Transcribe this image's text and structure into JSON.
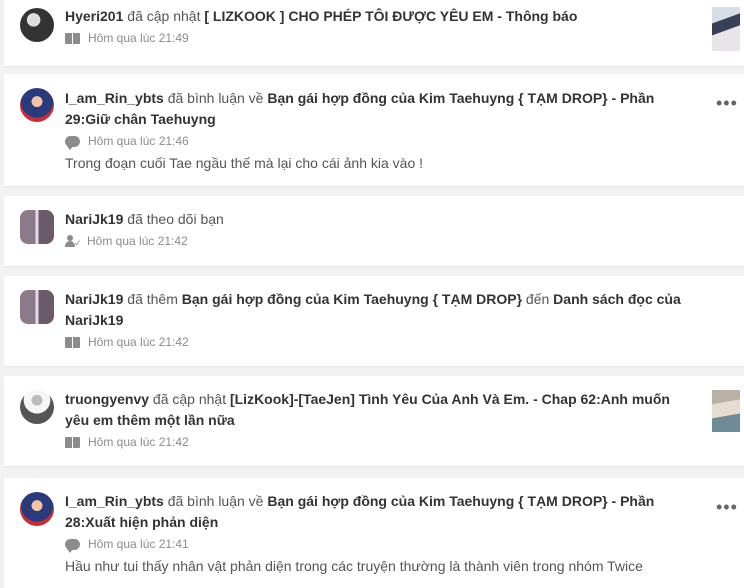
{
  "notifications": [
    {
      "user": "Hyeri201",
      "verb": "đã cập nhật",
      "story": "[ LIZKOOK ] CHO PHÉP TÔI ĐƯỢC YÊU EM - Thông báo",
      "time": "Hôm qua lúc 21:49",
      "icon": "book-icon"
    },
    {
      "user": "I_am_Rin_ybts",
      "verb": "đã bình luận về",
      "story": "Bạn gái hợp đồng của Kim Taehuyng { TẠM DROP} - Phần 29:Giữ chân Taehuyng",
      "time": "Hôm qua lúc 21:46",
      "comment": "Trong đoạn cuối Tae ngầu thế mà lại cho cái ảnh kia vào !",
      "icon": "comment-icon"
    },
    {
      "user": "NariJk19",
      "verb": "đã theo dõi bạn",
      "time": "Hôm qua lúc 21:42",
      "icon": "follow-icon"
    },
    {
      "user": "NariJk19",
      "verb": "đã thêm",
      "story": "Bạn gái hợp đồng của Kim Taehuyng { TẠM DROP}",
      "verb2": "đến",
      "list": "Danh sách đọc của NariJk19",
      "time": "Hôm qua lúc 21:42",
      "icon": "book-icon"
    },
    {
      "user": "truongyenvy",
      "verb": "đã cập nhật",
      "story": "[LizKook]-[TaeJen] Tình Yêu Của Anh Và Em. - Chap 62:Anh muốn yêu em thêm một lần nữa",
      "time": "Hôm qua lúc 21:42",
      "icon": "book-icon"
    },
    {
      "user": "I_am_Rin_ybts",
      "verb": "đã bình luận về",
      "story": "Bạn gái hợp đồng của Kim Taehuyng { TẠM DROP} - Phần 28:Xuất hiện phản diện",
      "time": "Hôm qua lúc 21:41",
      "comment": "Hầu như tui thấy nhân vật phản diện trong các truyện thường là thành viên trong nhóm Twice",
      "icon": "comment-icon"
    }
  ],
  "more_glyph": "•••"
}
